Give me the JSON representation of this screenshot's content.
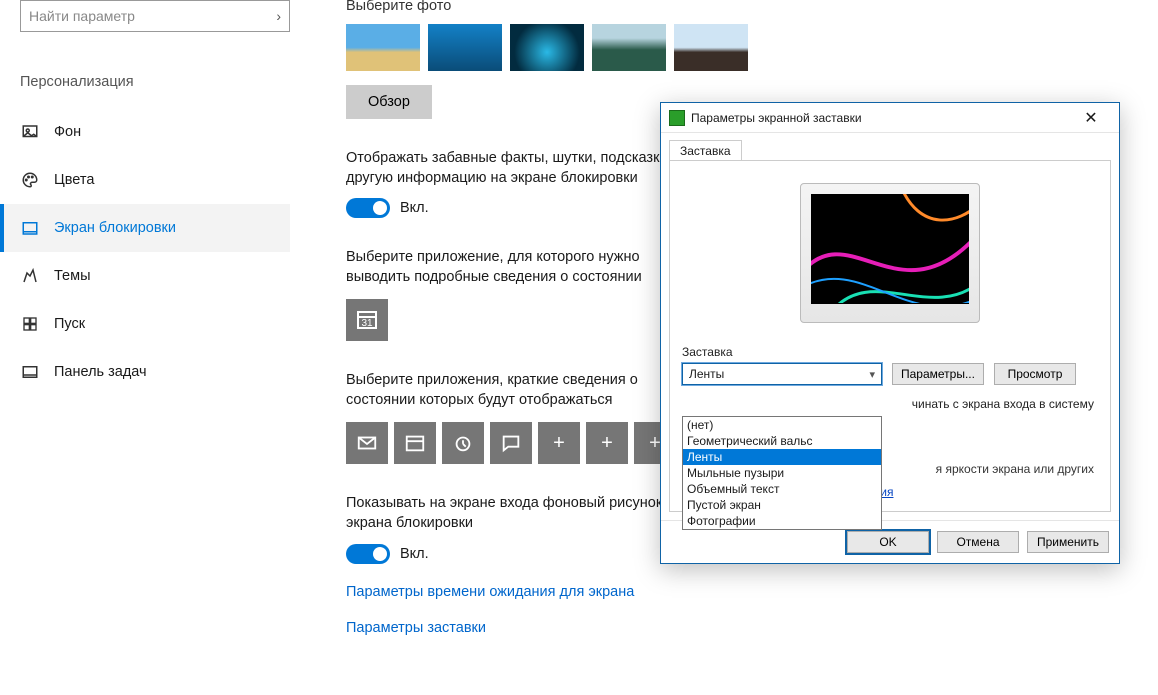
{
  "search": {
    "placeholder": "Найти параметр"
  },
  "sidebar": {
    "section": "Персонализация",
    "items": [
      {
        "label": "Фон"
      },
      {
        "label": "Цвета"
      },
      {
        "label": "Экран блокировки"
      },
      {
        "label": "Темы"
      },
      {
        "label": "Пуск"
      },
      {
        "label": "Панель задач"
      }
    ]
  },
  "content": {
    "choose_photo": "Выберите фото",
    "browse": "Обзор",
    "fun_facts": "Отображать забавные факты, шутки, подсказки и другую информацию на экране блокировки",
    "on": "Вкл.",
    "detailed_app": "Выберите приложение, для которого нужно выводить подробные сведения о состоянии",
    "quick_apps": "Выберите приложения, краткие сведения о состоянии которых будут отображаться",
    "show_bg": "Показывать на экране входа фоновый рисунок экрана блокировки",
    "timeout_link": "Параметры времени ожидания для экрана",
    "saver_link": "Параметры заставки"
  },
  "dialog": {
    "title": "Параметры экранной заставки",
    "tab": "Заставка",
    "group": "Заставка",
    "selected": "Ленты",
    "options": [
      "(нет)",
      "Геометрический вальс",
      "Ленты",
      "Мыльные пузыри",
      "Объемный текст",
      "Пустой экран",
      "Фотографии"
    ],
    "params": "Параметры...",
    "preview": "Просмотр",
    "wait_tail": "чинать с экрана входа в систему",
    "pm_desc_tail": "я яркости экрана или других",
    "pm_link": "Изменить параметры электропитания",
    "ok": "OK",
    "cancel": "Отмена",
    "apply": "Применить"
  }
}
